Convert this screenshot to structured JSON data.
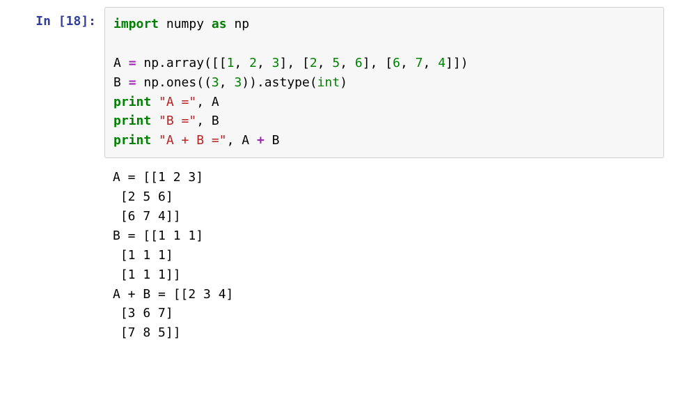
{
  "prompt": {
    "label": "In [18]:"
  },
  "code": {
    "tok": {
      "import": "import",
      "numpy": "numpy",
      "as": "as",
      "np": "np",
      "A": "A",
      "B": "B",
      "eq": "=",
      "plus": "+",
      "np_array_open": "np.array([[",
      "comma_sp": ", ",
      "br_mid": "], [",
      "array_close": "]])",
      "np_ones_open": "np.ones((",
      "ones_close": ")).astype(",
      "int": "int",
      "rparen": ")",
      "print": "print",
      "sp": " ",
      "strA": "\"A =\"",
      "strB": "\"B =\"",
      "strAB": "\"A + B =\"",
      "n1": "1",
      "n2": "2",
      "n3": "3",
      "n5": "5",
      "n6": "6",
      "n7": "7",
      "n4": "4"
    }
  },
  "output": {
    "lines": {
      "l1": "A = [[1 2 3]",
      "l2": " [2 5 6]",
      "l3": " [6 7 4]]",
      "l4": "B = [[1 1 1]",
      "l5": " [1 1 1]",
      "l6": " [1 1 1]]",
      "l7": "A + B = [[2 3 4]",
      "l8": " [3 6 7]",
      "l9": " [7 8 5]]"
    }
  }
}
